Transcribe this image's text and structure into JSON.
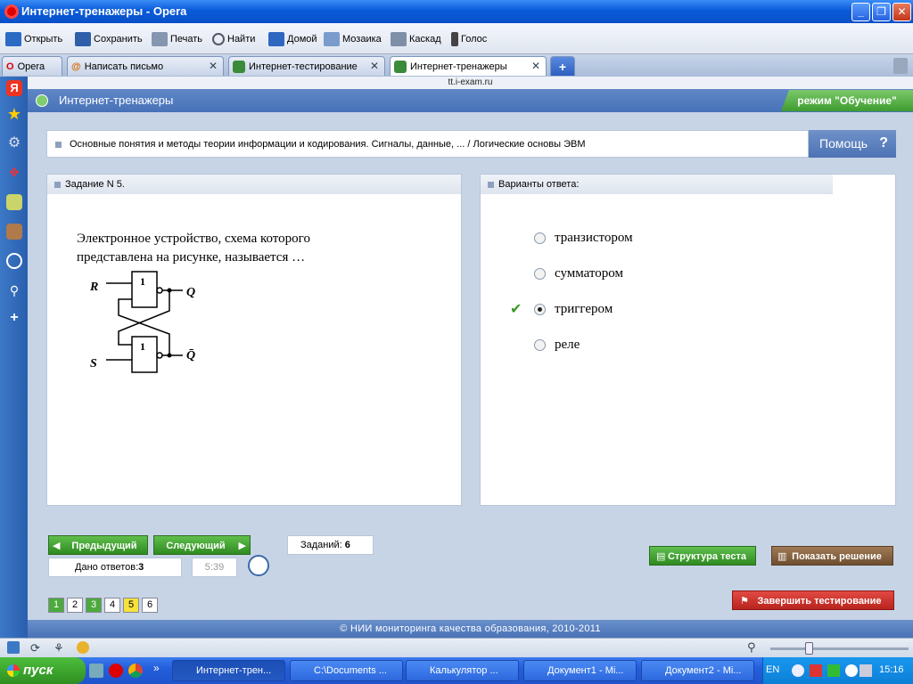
{
  "window": {
    "title": "Интернет-тренажеры - Opera",
    "min_icon": "minimize-icon",
    "max_icon": "maximize-icon",
    "close_icon": "close-icon"
  },
  "toolbar": {
    "open": "Открыть",
    "save": "Сохранить",
    "print": "Печать",
    "find": "Найти",
    "home": "Домой",
    "mosaic": "Мозаика",
    "cascade": "Каскад",
    "voice": "Голос"
  },
  "tabs": {
    "opera_menu": "Opera",
    "items": [
      {
        "label": "Написать письмо"
      },
      {
        "label": "Интернет-тестирование"
      },
      {
        "label": "Интернет-тренажеры"
      }
    ],
    "new_tab": "+"
  },
  "address": "tt.i-exam.ru",
  "header": {
    "title": "Интернет-тренажеры",
    "mode": "режим \"Обучение\""
  },
  "topic": "Основные понятия и методы теории информации и кодирования. Сигналы, данные, ... / Логические основы ЭВМ",
  "help": {
    "label": "Помощь",
    "q": "?"
  },
  "question": {
    "header": "Задание N 5.",
    "line1": "Электронное устройство, схема которого",
    "line2": "представлена на рисунке, называется …",
    "diagram": {
      "r": "R",
      "s": "S",
      "q": "Q",
      "q_bar": "Q̄",
      "gate1": "1",
      "gate2": "1"
    }
  },
  "answers": {
    "header": "Варианты ответа:",
    "options": [
      {
        "label": "транзистором",
        "selected": false
      },
      {
        "label": "сумматором",
        "selected": false
      },
      {
        "label": "триггером",
        "selected": true
      },
      {
        "label": "реле",
        "selected": false
      }
    ],
    "check_icon": "checkmark-icon"
  },
  "nav": {
    "prev": "Предыдущий",
    "next": "Следующий",
    "tasks_label": "Заданий:",
    "tasks_count": "6",
    "answered_label": "Дано ответов:",
    "answered_count": "3",
    "timer": "5:39",
    "pages": [
      "1",
      "2",
      "3",
      "4",
      "5",
      "6"
    ]
  },
  "actions": {
    "structure": "Структура теста",
    "solution": "Показать решение",
    "finish": "Завершить тестирование"
  },
  "footer": "© НИИ мониторинга качества образования, 2010-2011",
  "taskbar": {
    "start": "пуск",
    "tasks": [
      "Интернет-трен...",
      "C:\\Documents ...",
      "Калькулятор ...",
      "Документ1 - Mi...",
      "Документ2 - Mi..."
    ],
    "lang": "EN",
    "time": "15:16"
  },
  "colors": {
    "accent_green": "#3d9c2f",
    "header_blue": "#4872b8",
    "finish_red": "#c9302c",
    "solution_brown": "#7a5a3a"
  }
}
